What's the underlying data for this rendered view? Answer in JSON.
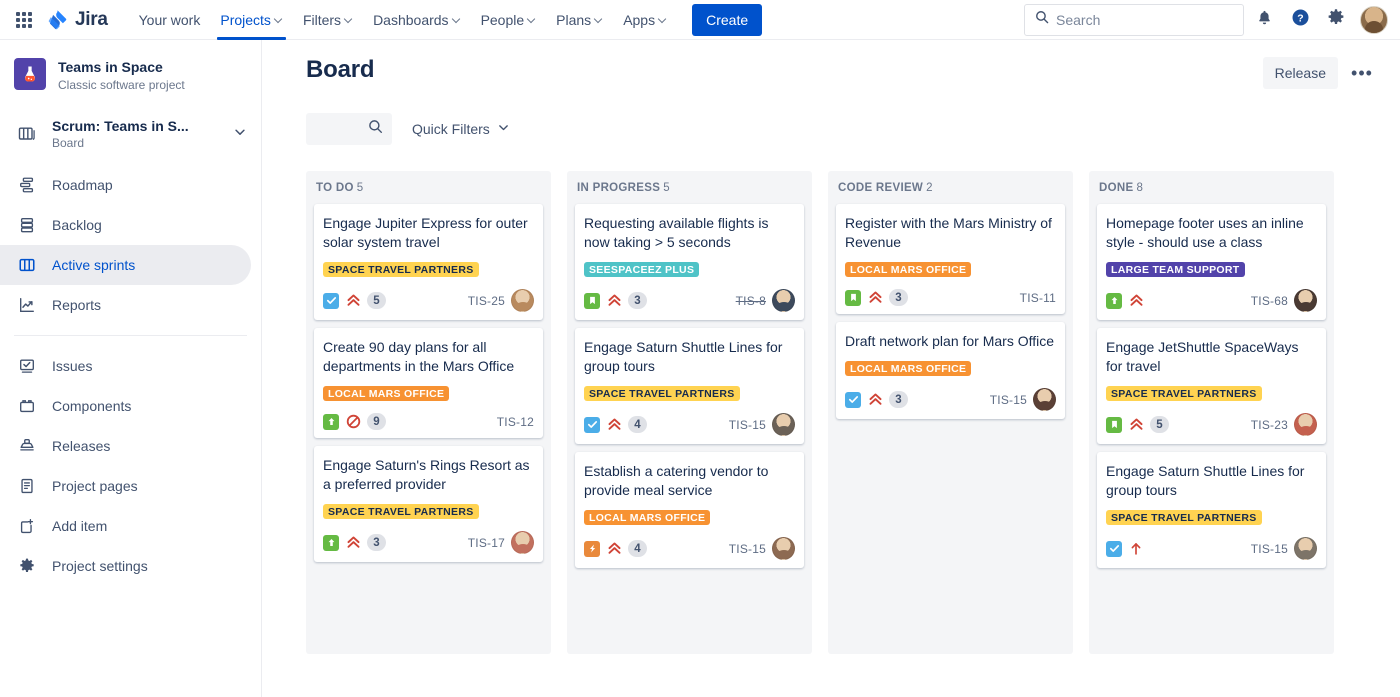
{
  "topnav": {
    "brand": "Jira",
    "items": [
      {
        "label": "Your work",
        "has_caret": false,
        "active": false
      },
      {
        "label": "Projects",
        "has_caret": true,
        "active": true
      },
      {
        "label": "Filters",
        "has_caret": true,
        "active": false
      },
      {
        "label": "Dashboards",
        "has_caret": true,
        "active": false
      },
      {
        "label": "People",
        "has_caret": true,
        "active": false
      },
      {
        "label": "Plans",
        "has_caret": true,
        "active": false
      },
      {
        "label": "Apps",
        "has_caret": true,
        "active": false
      }
    ],
    "create_label": "Create",
    "search_placeholder": "Search",
    "search_value": ""
  },
  "sidebar": {
    "project_name": "Teams in Space",
    "project_type": "Classic software project",
    "board_name": "Scrum: Teams in S...",
    "board_sub": "Board",
    "items": [
      {
        "label": "Roadmap",
        "icon": "roadmap-icon",
        "selected": false
      },
      {
        "label": "Backlog",
        "icon": "backlog-icon",
        "selected": false
      },
      {
        "label": "Active sprints",
        "icon": "board-columns-icon",
        "selected": true
      },
      {
        "label": "Reports",
        "icon": "reports-icon",
        "selected": false
      },
      {
        "label": "Issues",
        "icon": "issues-icon",
        "selected": false
      },
      {
        "label": "Components",
        "icon": "components-icon",
        "selected": false
      },
      {
        "label": "Releases",
        "icon": "releases-icon",
        "selected": false
      },
      {
        "label": "Project pages",
        "icon": "pages-icon",
        "selected": false
      },
      {
        "label": "Add item",
        "icon": "add-item-icon",
        "selected": false
      },
      {
        "label": "Project settings",
        "icon": "gear-icon",
        "selected": false
      }
    ]
  },
  "board": {
    "title": "Board",
    "release_label": "Release",
    "more_label": "•••",
    "search_value": "",
    "quick_filters_label": "Quick Filters",
    "columns": [
      {
        "name": "TO DO",
        "count": "5",
        "cards": [
          {
            "title": "Engage Jupiter Express for outer solar system travel",
            "epic": "SPACE TRAVEL PARTNERS",
            "epic_bg": "#FFD351",
            "epic_fg": "#172B4D",
            "type": "task",
            "priority": "highest",
            "points": "5",
            "key": "TIS-25",
            "key_done": false,
            "avatar": "#b98a5e"
          },
          {
            "title": "Create 90 day plans for all departments in the Mars Office",
            "epic": "LOCAL MARS OFFICE",
            "epic_bg": "#F79232",
            "epic_fg": "#FFFFFF",
            "type": "story",
            "priority": "blocker",
            "points": "9",
            "key": "TIS-12",
            "key_done": false,
            "avatar": ""
          },
          {
            "title": "Engage Saturn's Rings Resort as a preferred provider",
            "epic": "SPACE TRAVEL PARTNERS",
            "epic_bg": "#FFD351",
            "epic_fg": "#172B4D",
            "type": "story",
            "priority": "highest",
            "points": "3",
            "key": "TIS-17",
            "key_done": false,
            "avatar": "#c2705e"
          }
        ]
      },
      {
        "name": "IN PROGRESS",
        "count": "5",
        "cards": [
          {
            "title": "Requesting available flights is now taking > 5 seconds",
            "epic": "SEESPACEEZ PLUS",
            "epic_bg": "#4FC3C7",
            "epic_fg": "#FFFFFF",
            "type": "bookmark",
            "priority": "highest",
            "points": "3",
            "key": "TIS-8",
            "key_done": true,
            "avatar": "#3d4a5c"
          },
          {
            "title": "Engage Saturn Shuttle Lines for group tours",
            "epic": "SPACE TRAVEL PARTNERS",
            "epic_bg": "#FFD351",
            "epic_fg": "#172B4D",
            "type": "task",
            "priority": "highest",
            "points": "4",
            "key": "TIS-15",
            "key_done": false,
            "avatar": "#6b6157"
          },
          {
            "title": "Establish a catering vendor to provide meal service",
            "epic": "LOCAL MARS OFFICE",
            "epic_bg": "#F79232",
            "epic_fg": "#FFFFFF",
            "type": "improve",
            "priority": "highest",
            "points": "4",
            "key": "TIS-15",
            "key_done": false,
            "avatar": "#8d6a52"
          }
        ]
      },
      {
        "name": "CODE REVIEW",
        "count": "2",
        "cards": [
          {
            "title": "Register with the Mars Ministry of Revenue",
            "epic": "LOCAL MARS OFFICE",
            "epic_bg": "#F79232",
            "epic_fg": "#FFFFFF",
            "type": "bookmark",
            "priority": "highest",
            "points": "3",
            "key": "TIS-11",
            "key_done": false,
            "avatar": ""
          },
          {
            "title": "Draft network plan for Mars Office",
            "epic": "LOCAL MARS OFFICE",
            "epic_bg": "#F79232",
            "epic_fg": "#FFFFFF",
            "type": "task",
            "priority": "highest",
            "points": "3",
            "key": "TIS-15",
            "key_done": false,
            "avatar": "#5b4036"
          }
        ]
      },
      {
        "name": "DONE",
        "count": "8",
        "cards": [
          {
            "title": "Homepage footer uses an inline style - should use a class",
            "epic": "LARGE TEAM SUPPORT",
            "epic_bg": "#5243AA",
            "epic_fg": "#FFFFFF",
            "type": "story",
            "priority": "highest",
            "points": "",
            "key": "TIS-68",
            "key_done": false,
            "avatar": "#4a3a33"
          },
          {
            "title": "Engage JetShuttle SpaceWays for travel",
            "epic": "SPACE TRAVEL PARTNERS",
            "epic_bg": "#FFD351",
            "epic_fg": "#172B4D",
            "type": "bookmark",
            "priority": "highest",
            "points": "5",
            "key": "TIS-23",
            "key_done": false,
            "avatar": "#c4604e"
          },
          {
            "title": "Engage Saturn Shuttle Lines for group tours",
            "epic": "SPACE TRAVEL PARTNERS",
            "epic_bg": "#FFD351",
            "epic_fg": "#172B4D",
            "type": "task",
            "priority": "high",
            "points": "",
            "key": "TIS-15",
            "key_done": false,
            "avatar": "#7d7468"
          }
        ]
      }
    ]
  }
}
